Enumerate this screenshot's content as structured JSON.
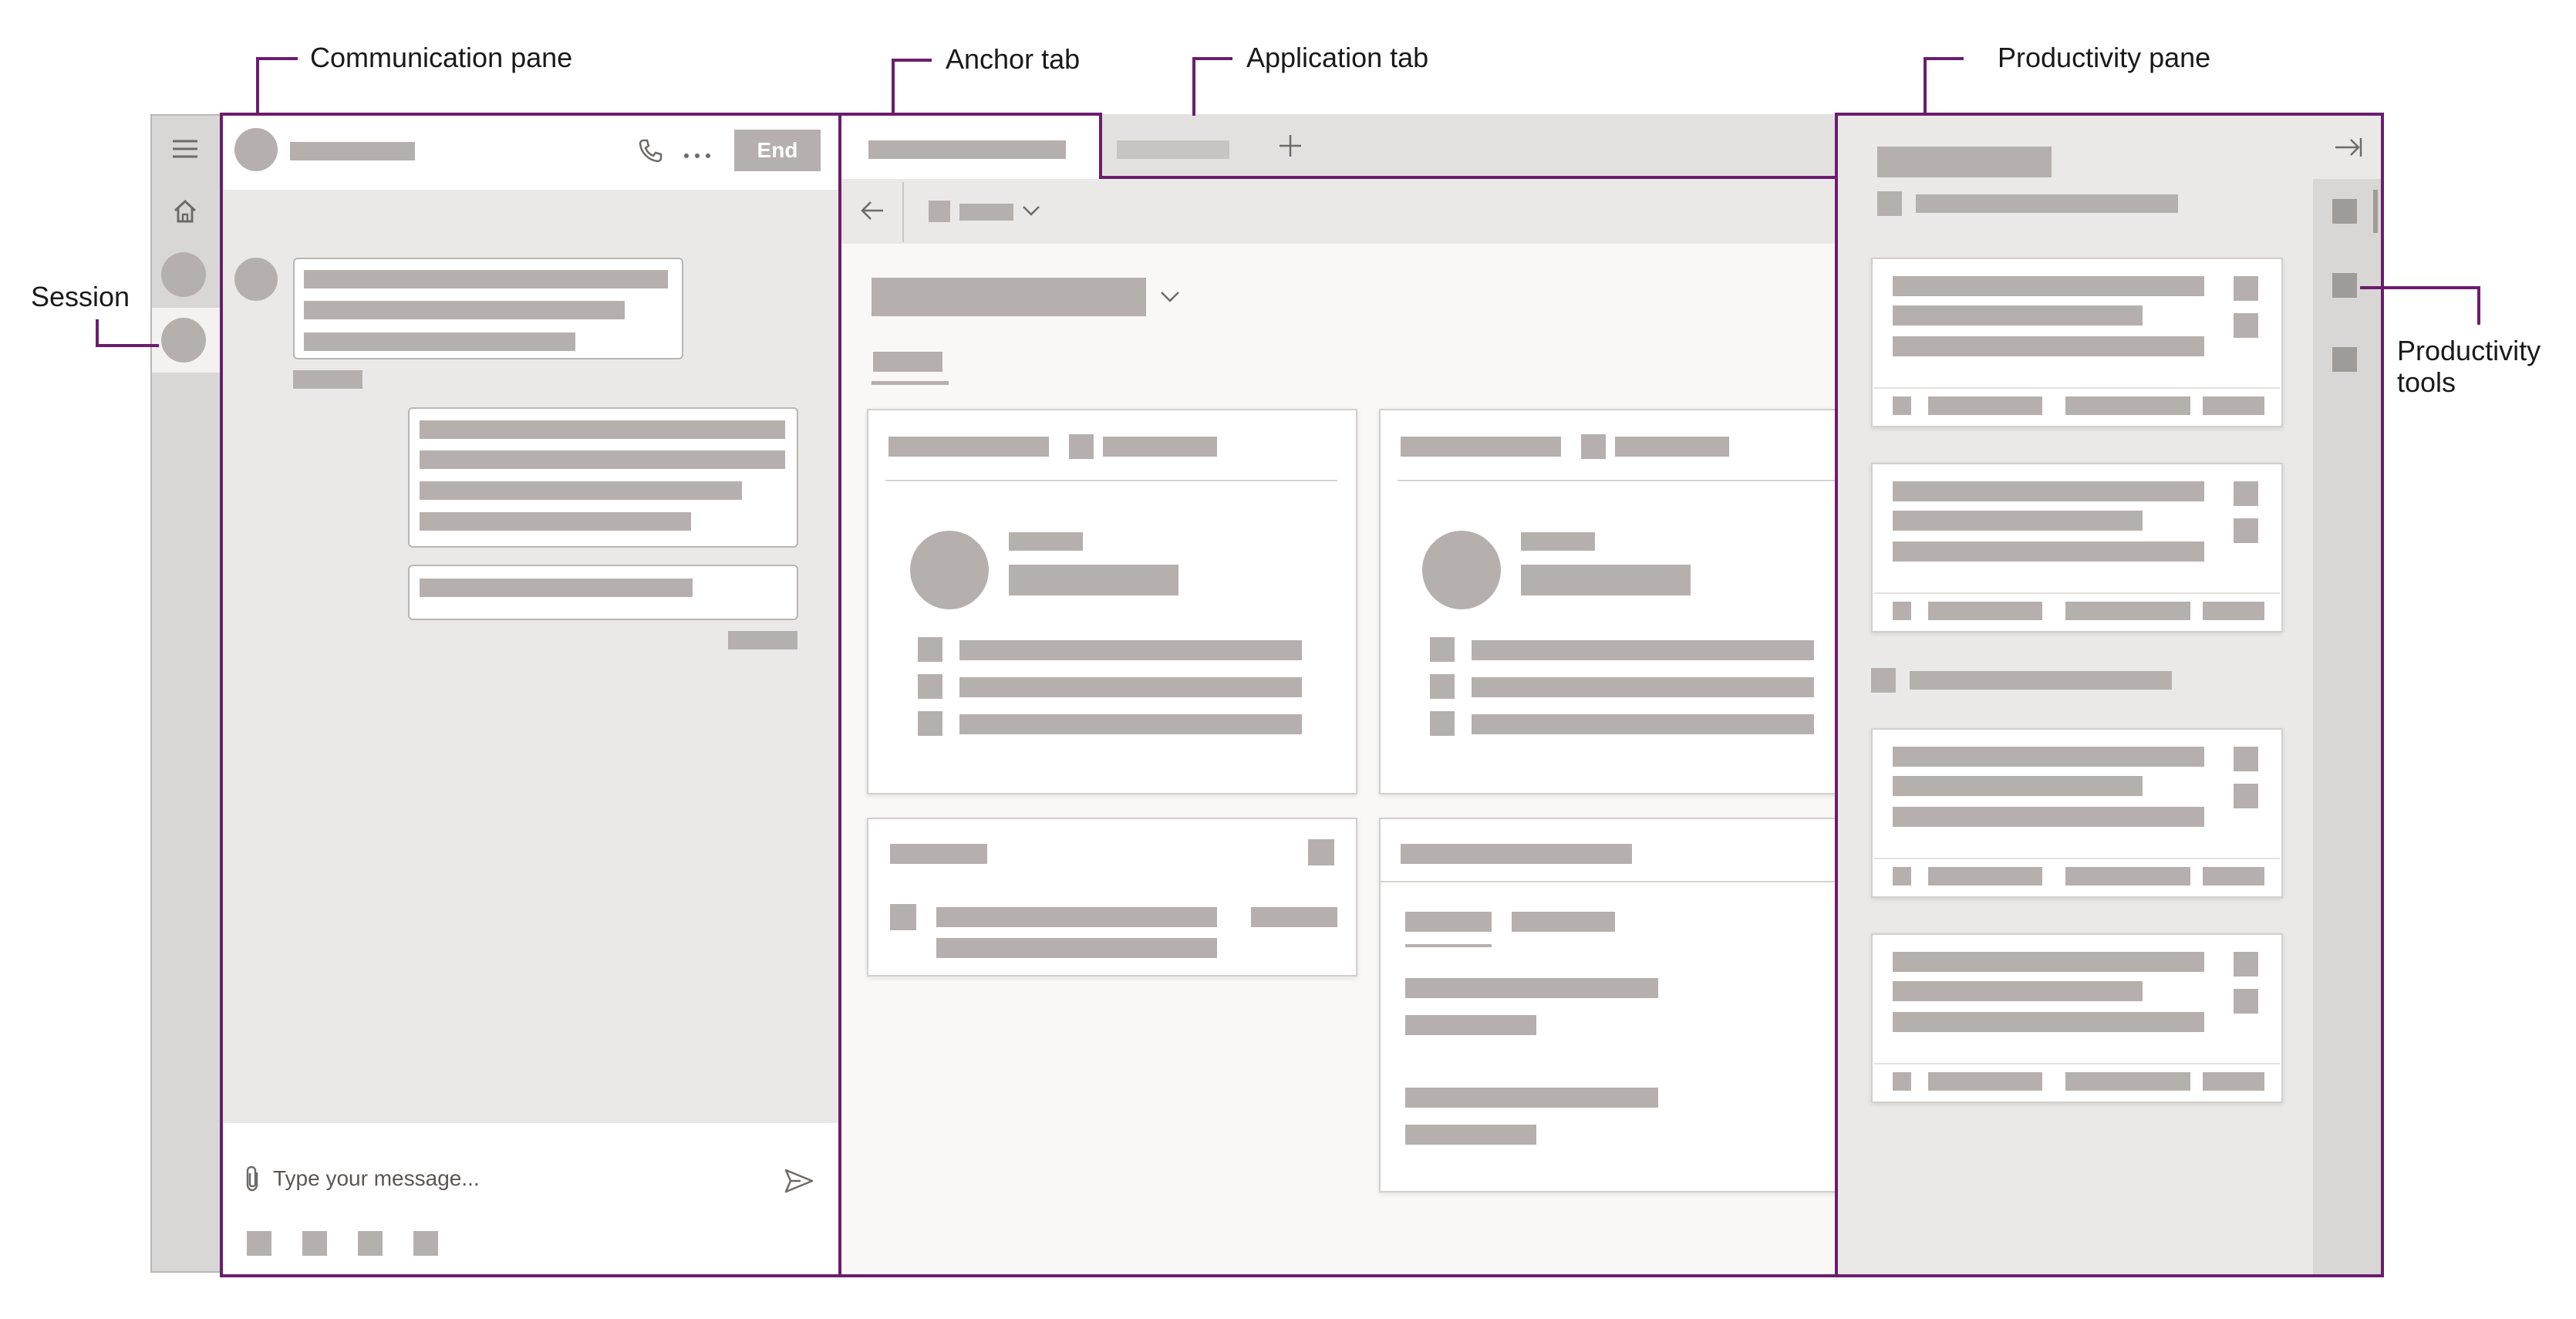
{
  "callouts": {
    "communication_pane": "Communication pane",
    "anchor_tab": "Anchor tab",
    "application_tab": "Application tab",
    "productivity_pane": "Productivity pane",
    "session": "Session",
    "productivity_tools_line1": "Productivity",
    "productivity_tools_line2": "tools"
  },
  "communication": {
    "end_button": "End",
    "message_placeholder": "Type your message..."
  },
  "icons": {
    "menu": "hamburger-menu-icon",
    "home": "home-icon",
    "phone": "phone-icon",
    "more": "ellipsis-icon",
    "back": "back-arrow-icon",
    "chevron": "chevron-down-icon",
    "add": "plus-icon",
    "attach": "paperclip-icon",
    "send": "send-icon",
    "collapse": "collapse-pane-icon"
  },
  "colors": {
    "accent_purple": "#6b1d6e",
    "placeholder_gray": "#b5b0ad",
    "end_button_bg": "#b5b0ad",
    "pane_bg": "#ebe9e7"
  }
}
